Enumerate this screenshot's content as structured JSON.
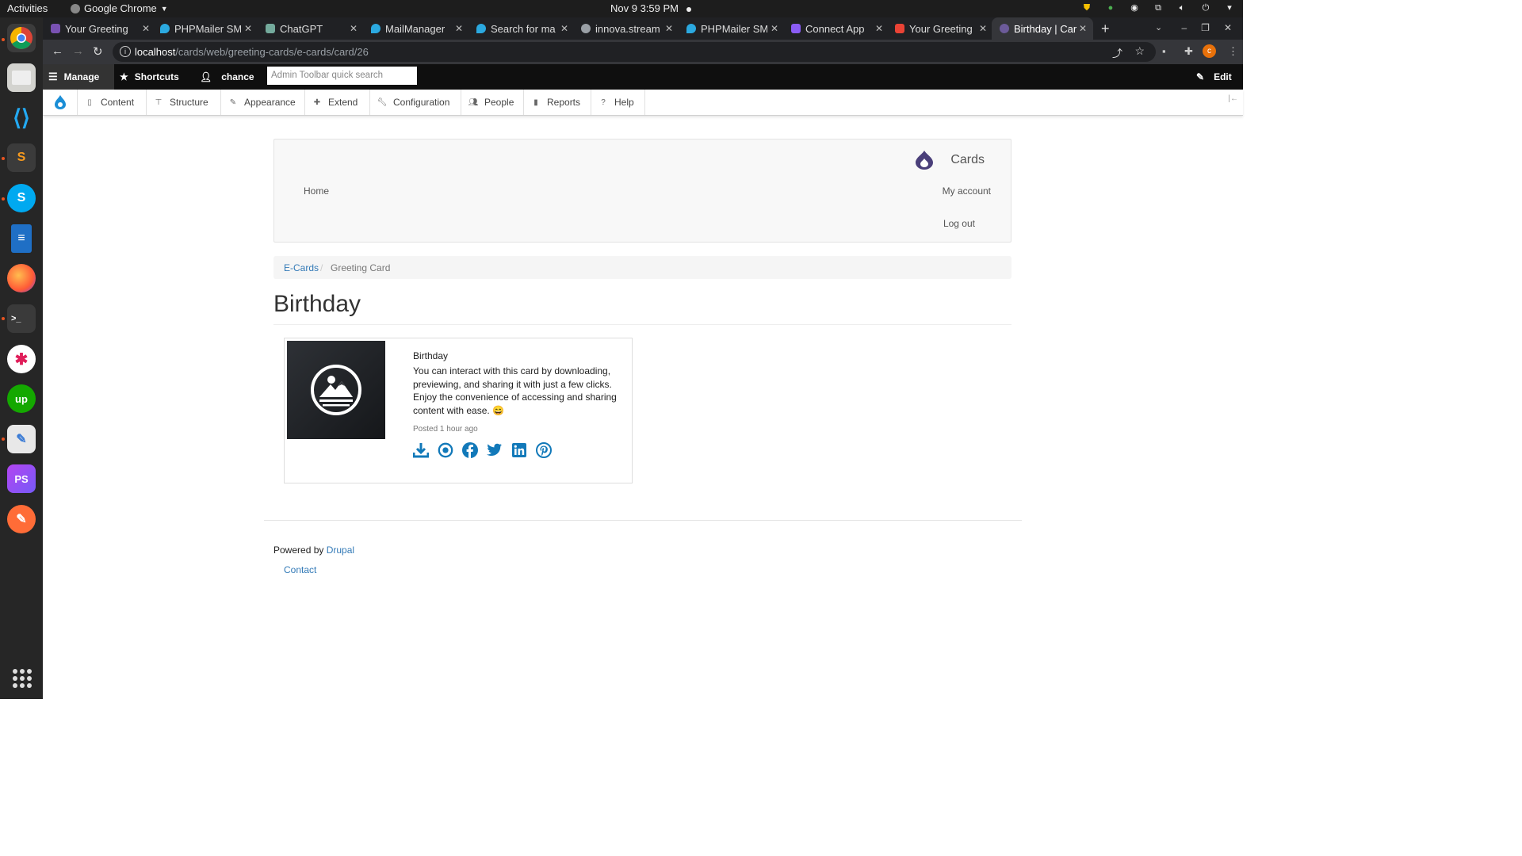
{
  "system": {
    "activities": "Activities",
    "app_name": "Google Chrome",
    "clock": "Nov 9  3:59 PM"
  },
  "dock": {
    "apps": [
      "Chrome",
      "Files",
      "VS Code",
      "Sublime Text",
      "Skype",
      "LibreOffice Writer",
      "Firefox",
      "Terminal",
      "Slack",
      "Upwork",
      "Text Editor",
      "PhpStorm",
      "Postman"
    ],
    "show_apps": "Show Applications"
  },
  "browser": {
    "tabs": [
      {
        "title": "Your Greeting"
      },
      {
        "title": "PHPMailer SM"
      },
      {
        "title": "ChatGPT"
      },
      {
        "title": "MailManager"
      },
      {
        "title": "Search for ma"
      },
      {
        "title": "innova.stream"
      },
      {
        "title": "PHPMailer SM"
      },
      {
        "title": "Connect App"
      },
      {
        "title": "Your Greeting"
      },
      {
        "title": "Birthday | Car"
      }
    ],
    "url_host": "localhost",
    "url_path": "/cards/web/greeting-cards/e-cards/card/26",
    "profile_initial": "c"
  },
  "admin_toolbar": {
    "manage": "Manage",
    "shortcuts": "Shortcuts",
    "user": "chance",
    "search_placeholder": "Admin Toolbar quick search",
    "edit": "Edit"
  },
  "admin_menu": {
    "items": [
      "Content",
      "Structure",
      "Appearance",
      "Extend",
      "Configuration",
      "People",
      "Reports",
      "Help"
    ]
  },
  "site": {
    "name": "Cards",
    "nav_home": "Home",
    "nav_account": "My account",
    "nav_logout": "Log out"
  },
  "breadcrumb": {
    "link": "E-Cards",
    "current": "Greeting Card"
  },
  "page": {
    "title": "Birthday"
  },
  "card": {
    "title": "Birthday",
    "body": "You can interact with this card by downloading, previewing, and sharing it with just a few clicks. Enjoy the convenience of accessing and sharing content with ease. 😄",
    "posted": "Posted 1 hour ago",
    "actions": [
      "download-icon",
      "preview-icon",
      "facebook-icon",
      "twitter-icon",
      "linkedin-icon",
      "pinterest-icon"
    ]
  },
  "footer": {
    "powered_by": "Powered by",
    "drupal": "Drupal",
    "contact": "Contact"
  },
  "colors": {
    "link": "#337ab7",
    "share_icons": "#1279b9",
    "admin_bar": "#0f0f0f"
  }
}
